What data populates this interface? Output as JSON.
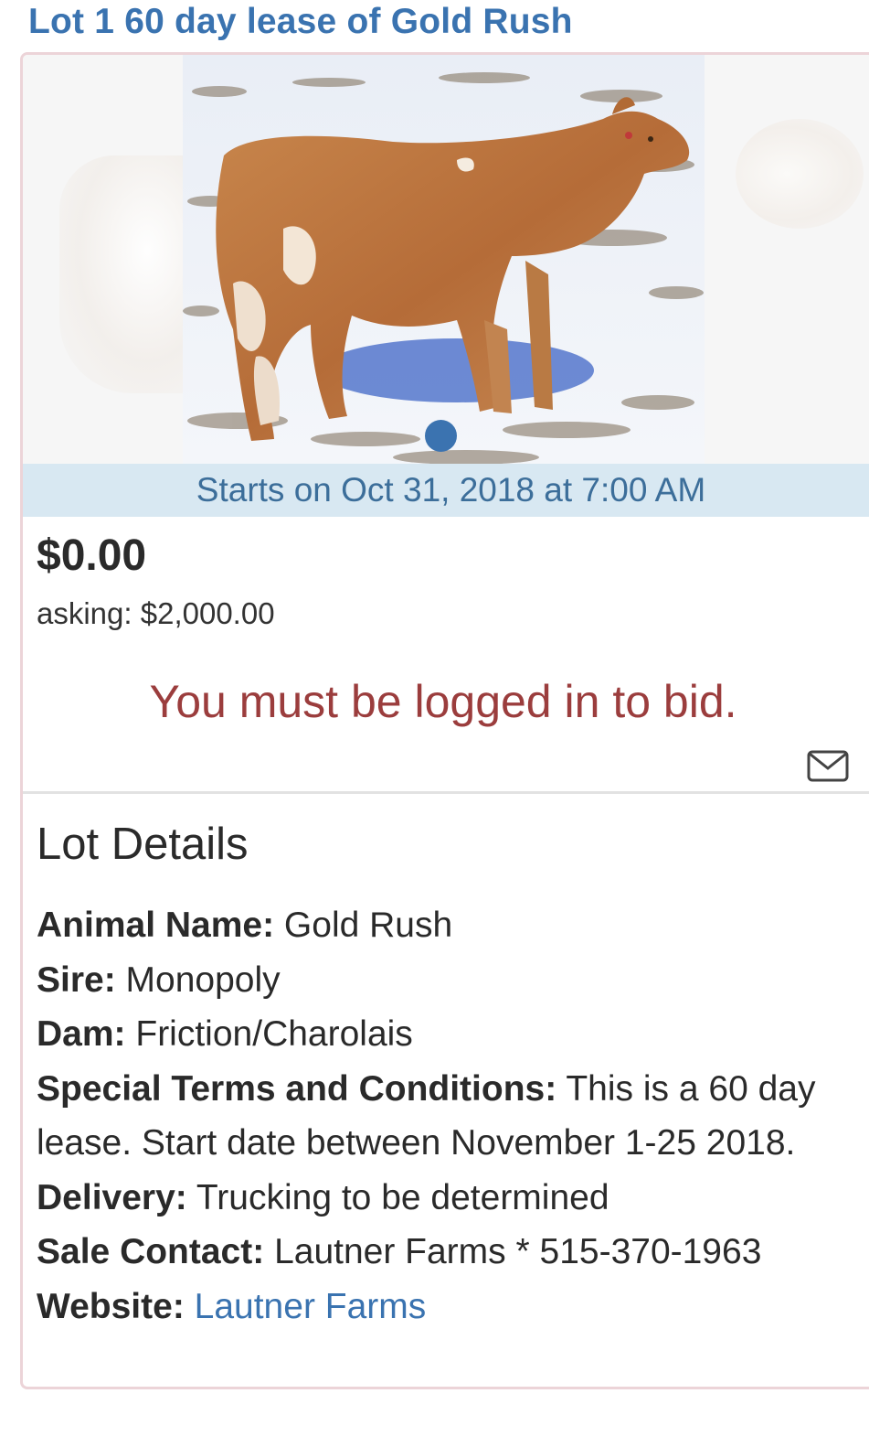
{
  "lot": {
    "title": "Lot 1 60 day lease of Gold Rush",
    "starts": "Starts on Oct 31, 2018 at 7:00 AM",
    "current_bid": "$0.00",
    "asking_label": "asking:",
    "asking_value": "$2,000.00",
    "login_message": "You must be logged in to bid.",
    "gallery": {
      "image_count": 1,
      "active_index": 0,
      "indicator_color": "#3b73b0"
    }
  },
  "details": {
    "heading": "Lot Details",
    "animal_name_label": "Animal Name:",
    "animal_name": "Gold Rush",
    "sire_label": "Sire:",
    "sire": "Monopoly",
    "dam_label": "Dam:",
    "dam": "Friction/Charolais",
    "terms_label": "Special Terms and Conditions:",
    "terms": "This is a 60 day lease. Start date between November 1-25 2018.",
    "delivery_label": "Delivery:",
    "delivery": "Trucking to be determined",
    "contact_label": "Sale Contact:",
    "contact": "Lautner Farms * 515-370-1963",
    "website_label": "Website:",
    "website_link": "Lautner Farms"
  },
  "icons": {
    "contact": "mail-icon"
  },
  "colors": {
    "link": "#3a73b0",
    "banner_bg": "#d8e8f2",
    "banner_text": "#3c6e9a",
    "alert_text": "#9b3d3d"
  }
}
